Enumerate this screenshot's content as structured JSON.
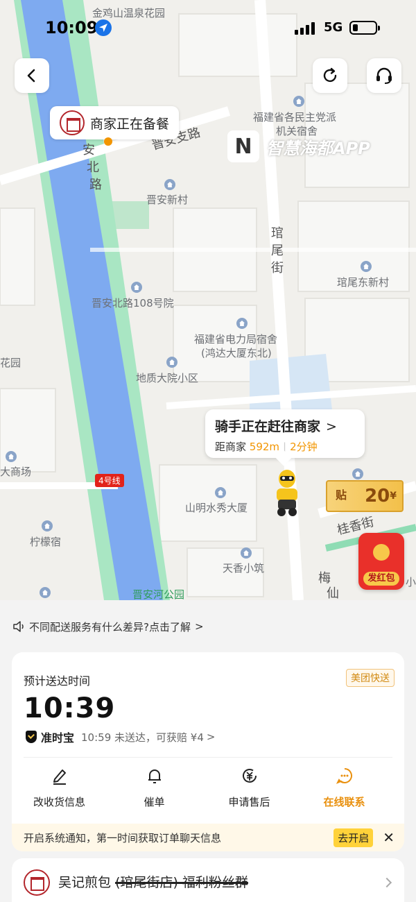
{
  "status_bar": {
    "time": "10:09",
    "network": "5G"
  },
  "map": {
    "labels": {
      "jinjishan": "金鸡山温泉花园",
      "minzhu": "福建省各民主党派",
      "minzhu2": "机关宿舍",
      "jinanzhi": "晋安支路",
      "an": "安",
      "bei": "北",
      "lu": "路",
      "jinanxincun": "晋安新村",
      "guan": "琯",
      "wei": "尾",
      "jie": "街",
      "guanweidong": "琯尾东新村",
      "jinan108": "晋安北路108号院",
      "dianli": "福建省电力局宿舍",
      "dianli2": "(鸿达大厦东北)",
      "huayuan": "花园",
      "dizhi": "地质大院小区",
      "shangchang": "大商场",
      "metro": "4号线",
      "shanming": "山明水秀大厦",
      "guixiang": "桂香街",
      "ningmeng": "柠檬宿",
      "tianxiang": "天香小筑",
      "mei": "梅",
      "xian": "仙",
      "xiao": "小",
      "park": "晋安河公园"
    },
    "merchant_status": "商家正在备餐",
    "watermark_text": "智慧海都APP",
    "watermark_logo": "N",
    "rider_card": {
      "title": "骑手正在赶往商家",
      "arrow": ">",
      "distance_label": "距商家",
      "distance": "592m",
      "eta": "2分钟"
    },
    "coupon": {
      "tag": "贴",
      "amount": "20",
      "unit": "¥"
    },
    "red_packet": "发红包"
  },
  "notice": {
    "text": "不同配送服务有什么差异?点击了解",
    "arrow": ">"
  },
  "delivery_card": {
    "eta_label": "预计送达时间",
    "brand": "美团快送",
    "eta_time": "10:39",
    "guarantee_name": "准时宝",
    "guarantee_text": "10:59 未送达，可获赔 ¥4",
    "guarantee_arrow": ">",
    "actions": [
      {
        "label": "改收货信息",
        "icon": "edit-icon"
      },
      {
        "label": "催单",
        "icon": "bell-icon"
      },
      {
        "label": "申请售后",
        "icon": "after-sale-icon"
      },
      {
        "label": "在线联系",
        "icon": "chat-icon"
      }
    ],
    "system_notice": "开启系统通知，第一时间获取订单聊天信息",
    "system_notice_button": "去开启",
    "system_notice_close": "✕"
  },
  "shop": {
    "name_a": "吴记煎包",
    "name_b": "(琯尾街店) 福利粉丝群"
  },
  "colors": {
    "accent": "#f29500",
    "river": "#7eaaf0",
    "green": "#8fdcb4",
    "red": "#e9302a"
  }
}
